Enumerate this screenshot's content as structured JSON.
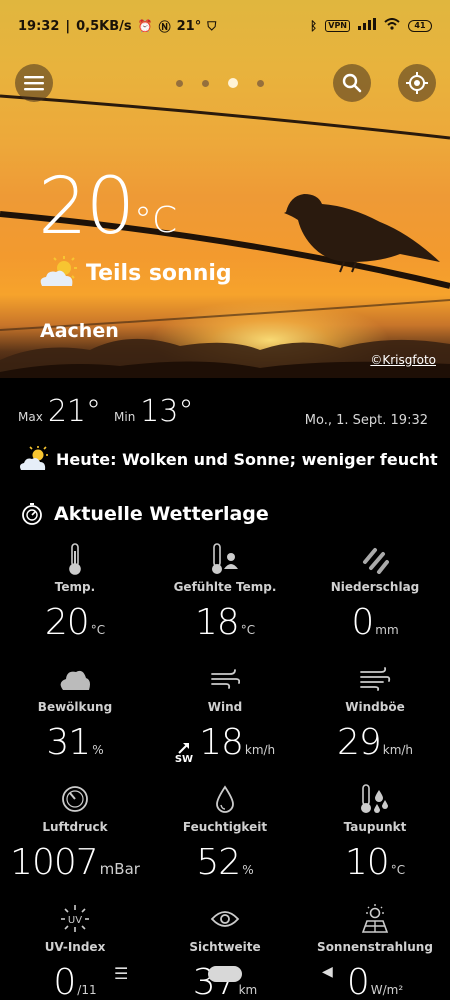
{
  "status_bar": {
    "time": "19:32",
    "net_speed": "0,5KB/s",
    "temp": "21°",
    "vpn": "VPN",
    "battery": "41"
  },
  "hero": {
    "temperature": "20",
    "temp_unit": "°C",
    "condition": "Teils sonnig",
    "city": "Aachen",
    "photo_credit": "©Krisgfoto",
    "pager_count": 4,
    "pager_active": 2
  },
  "today": {
    "max_label": "Max",
    "max_value": "21°",
    "min_label": "Min",
    "min_value": "13°",
    "date": "Mo., 1. Sept. 19:32",
    "summary": "Heute: Wolken und Sonne; weniger feucht"
  },
  "current": {
    "title": "Aktuelle Wetterlage",
    "items": [
      {
        "label": "Temp.",
        "value": "20",
        "unit": "°C",
        "icon": "thermometer-icon"
      },
      {
        "label": "Gefühlte Temp.",
        "value": "18",
        "unit": "°C",
        "icon": "feels-like-icon"
      },
      {
        "label": "Niederschlag",
        "value": "0",
        "unit": "mm",
        "icon": "rain-icon"
      },
      {
        "label": "Bewölkung",
        "value": "31",
        "unit": "%",
        "icon": "cloud-icon"
      },
      {
        "label": "Wind",
        "value": "18",
        "unit": "km/h",
        "direction": "SW",
        "icon": "wind-icon"
      },
      {
        "label": "Windböe",
        "value": "29",
        "unit": "km/h",
        "icon": "gust-icon"
      },
      {
        "label": "Luftdruck",
        "value": "1007",
        "unit": "mBar",
        "icon": "pressure-icon"
      },
      {
        "label": "Feuchtigkeit",
        "value": "52",
        "unit": "%",
        "icon": "humidity-icon"
      },
      {
        "label": "Taupunkt",
        "value": "10",
        "unit": "°C",
        "icon": "dewpoint-icon"
      },
      {
        "label": "UV-Index",
        "value": "0",
        "unit": "/11",
        "icon": "uv-icon"
      },
      {
        "label": "Sichtweite",
        "value": "37",
        "unit": "km",
        "icon": "eye-icon"
      },
      {
        "label": "Sonnenstrahlung",
        "value": "0",
        "unit": "W/m²",
        "icon": "solar-icon"
      }
    ]
  },
  "colors": {
    "sky_top": "#e0b63e",
    "sky_bottom": "#f39a2e",
    "background": "#000000"
  }
}
